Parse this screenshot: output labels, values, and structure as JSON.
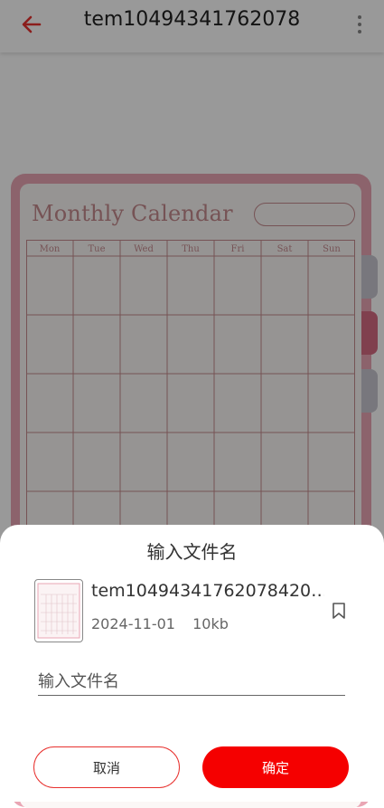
{
  "app_bar": {
    "title": "tem10494341762078",
    "back_icon": "arrow-left-icon",
    "more_icon": "more-vertical-icon",
    "accent_color": "#e8322f"
  },
  "preview": {
    "calendar_title": "Monthly Calendar",
    "weekdays": [
      "Mon",
      "Tue",
      "Wed",
      "Thu",
      "Fri",
      "Sat",
      "Sun"
    ],
    "frame_color": "#e9a6b4",
    "text_color": "#c58a8e"
  },
  "dialog": {
    "title": "输入文件名",
    "file": {
      "name": "tem10494341762078420…",
      "date": "2024-11-01",
      "size": "10kb",
      "thumbnail_icon": "calendar-thumbnail",
      "bookmark_icon": "bookmark-icon"
    },
    "input": {
      "placeholder": "输入文件名",
      "value": ""
    },
    "cancel_label": "取消",
    "confirm_label": "确定",
    "confirm_color": "#f50000"
  }
}
